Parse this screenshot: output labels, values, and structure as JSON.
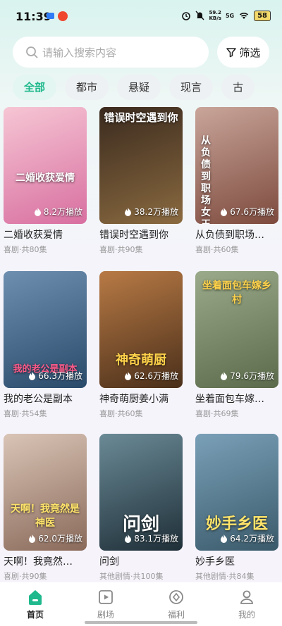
{
  "status": {
    "time": "11:39",
    "net_speed_top": "59.2",
    "net_speed_bottom": "KB/s",
    "network": "5G",
    "battery": "58"
  },
  "search": {
    "placeholder": "请输入搜索内容",
    "filter_label": "筛选"
  },
  "categories": [
    {
      "label": "全部",
      "active": true
    },
    {
      "label": "都市"
    },
    {
      "label": "悬疑"
    },
    {
      "label": "现言"
    },
    {
      "label": "古"
    }
  ],
  "dramas": [
    {
      "title": "二婚收获爱情",
      "genre_episodes": "喜剧·共80集",
      "plays": "8.2万播放",
      "poster_text": "二婚收获爱情",
      "colors": [
        "#f6c6d4",
        "#d86fa0"
      ]
    },
    {
      "title": "错误时空遇到你",
      "genre_episodes": "喜剧·共90集",
      "plays": "38.2万播放",
      "poster_text": "错误时空遇到你",
      "colors": [
        "#3a2a1e",
        "#8a6a40"
      ]
    },
    {
      "title": "从负债到职场…",
      "genre_episodes": "喜剧·共60集",
      "plays": "67.6万播放",
      "poster_text": "从负债到职场女王",
      "colors": [
        "#c9a59a",
        "#7d4a3d"
      ]
    },
    {
      "title": "我的老公是副本",
      "genre_episodes": "喜剧·共54集",
      "plays": "66.3万播放",
      "poster_text": "我的老公是副本",
      "colors": [
        "#6e8fb0",
        "#2a4a6a"
      ]
    },
    {
      "title": "神奇萌厨姜小满",
      "genre_episodes": "喜剧·共60集",
      "plays": "62.6万播放",
      "poster_text": "神奇萌厨",
      "colors": [
        "#b87a45",
        "#4a2f1a"
      ]
    },
    {
      "title": "坐着面包车嫁…",
      "genre_episodes": "喜剧·共69集",
      "plays": "79.6万播放",
      "poster_text": "坐着面包车嫁乡村",
      "colors": [
        "#9aaa8a",
        "#5a6a4a"
      ]
    },
    {
      "title": "天啊！我竟然…",
      "genre_episodes": "喜剧·共90集",
      "plays": "62.0万播放",
      "poster_text": "天啊！我竟然是神医",
      "colors": [
        "#d9c4b6",
        "#8a6a5a"
      ]
    },
    {
      "title": "问剑",
      "genre_episodes": "其他剧情·共100集",
      "plays": "83.1万播放",
      "poster_text": "问剑",
      "colors": [
        "#6a8a96",
        "#1f2f38"
      ]
    },
    {
      "title": "妙手乡医",
      "genre_episodes": "其他剧情·共84集",
      "plays": "64.2万播放",
      "poster_text": "妙手乡医",
      "colors": [
        "#7aa0b8",
        "#3a5a6a"
      ]
    }
  ],
  "nav": [
    {
      "label": "首页",
      "icon": "home-icon",
      "active": true
    },
    {
      "label": "剧场",
      "icon": "theater-icon"
    },
    {
      "label": "福利",
      "icon": "welfare-icon"
    },
    {
      "label": "我的",
      "icon": "profile-icon"
    }
  ],
  "accent_color": "#1fb98d"
}
